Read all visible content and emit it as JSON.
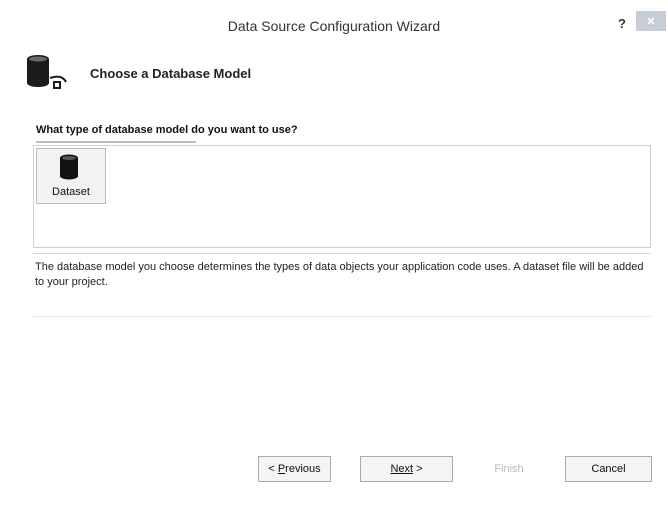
{
  "window": {
    "title": "Data Source Configuration Wizard",
    "help_label": "?",
    "close_label": "✕"
  },
  "header": {
    "icon": "database-connection-icon",
    "title": "Choose a Database Model"
  },
  "question": "What type of database model do you want to use?",
  "models": [
    {
      "label": "Dataset",
      "icon": "database-icon",
      "selected": true
    }
  ],
  "description": "The database model you choose determines the types of data objects your application code uses. A dataset file will be added to your project.",
  "buttons": {
    "previous": {
      "prefix": "< ",
      "mnemonic": "P",
      "rest": "revious"
    },
    "next": {
      "mnemonic": "N",
      "rest": "ext",
      "suffix": " >"
    },
    "finish": {
      "label": "Finish",
      "enabled": false
    },
    "cancel": {
      "label": "Cancel"
    }
  }
}
